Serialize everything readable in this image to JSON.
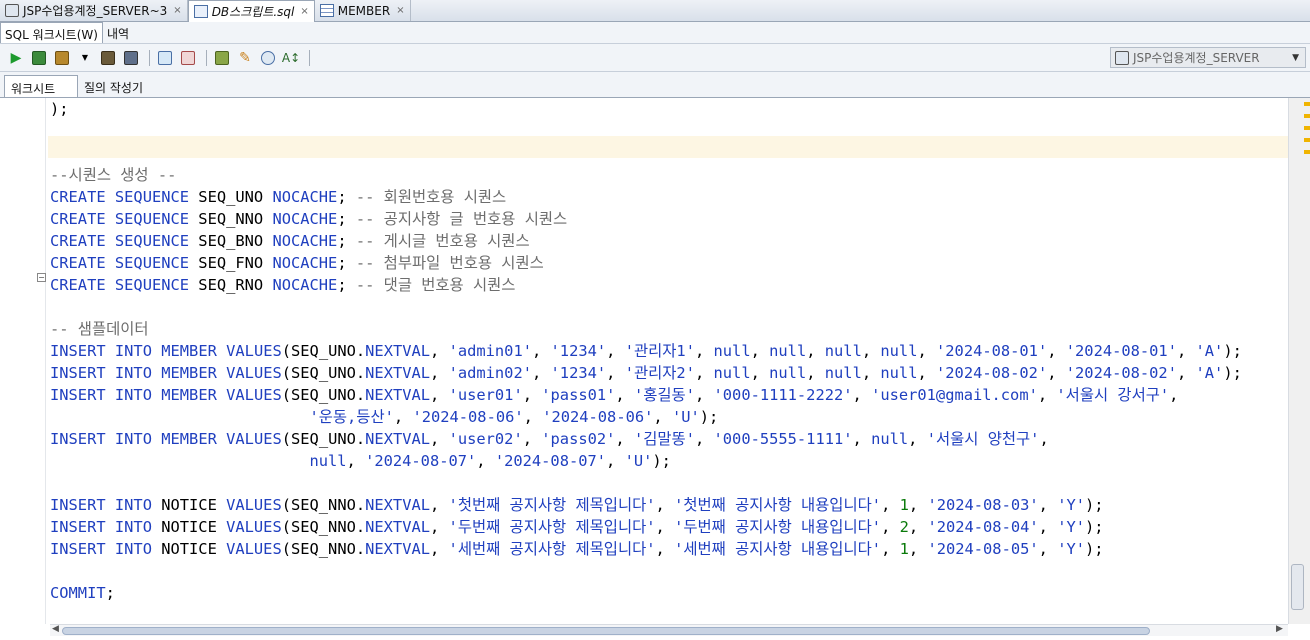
{
  "tabs": [
    {
      "label": "JSP수업용계정_SERVER~3",
      "icon": "database-icon",
      "close": "×"
    },
    {
      "label": "DB스크립트.sql",
      "icon": "sql-file-icon",
      "close": "×"
    },
    {
      "label": "MEMBER",
      "icon": "table-icon",
      "close": "×"
    }
  ],
  "subtabs": [
    "SQL 워크시트(W)",
    "내역"
  ],
  "connection": {
    "label": "JSP수업용계정_SERVER"
  },
  "worksheet_tabs": [
    "워크시트",
    "질의 작성기"
  ],
  "code_lines": [
    ");",
    "",
    "",
    "--시퀀스 생성 --",
    "CREATE SEQUENCE SEQ_UNO NOCACHE; -- 회원번호용 시퀀스",
    "CREATE SEQUENCE SEQ_NNO NOCACHE; -- 공지사항 글 번호용 시퀀스",
    "CREATE SEQUENCE SEQ_BNO NOCACHE; -- 게시글 번호용 시퀀스",
    "CREATE SEQUENCE SEQ_FNO NOCACHE; -- 첨부파일 번호용 시퀀스",
    "CREATE SEQUENCE SEQ_RNO NOCACHE; -- 댓글 번호용 시퀀스",
    "",
    "-- 샘플데이터",
    "INSERT INTO MEMBER VALUES(SEQ_UNO.NEXTVAL, 'admin01', '1234', '관리자1', null, null, null, null, '2024-08-01', '2024-08-01', 'A');",
    "INSERT INTO MEMBER VALUES(SEQ_UNO.NEXTVAL, 'admin02', '1234', '관리자2', null, null, null, null, '2024-08-02', '2024-08-02', 'A');",
    "INSERT INTO MEMBER VALUES(SEQ_UNO.NEXTVAL, 'user01', 'pass01', '홍길동', '000-1111-2222', 'user01@gmail.com', '서울시 강서구',",
    "                            '운동,등산', '2024-08-06', '2024-08-06', 'U');",
    "INSERT INTO MEMBER VALUES(SEQ_UNO.NEXTVAL, 'user02', 'pass02', '김말똥', '000-5555-1111', null, '서울시 양천구',",
    "                            null, '2024-08-07', '2024-08-07', 'U');",
    "",
    "INSERT INTO NOTICE VALUES(SEQ_NNO.NEXTVAL, '첫번째 공지사항 제목입니다', '첫번째 공지사항 내용입니다', 1, '2024-08-03', 'Y');",
    "INSERT INTO NOTICE VALUES(SEQ_NNO.NEXTVAL, '두번째 공지사항 제목입니다', '두번째 공지사항 내용입니다', 2, '2024-08-04', 'Y');",
    "INSERT INTO NOTICE VALUES(SEQ_NNO.NEXTVAL, '세번째 공지사항 제목입니다', '세번째 공지사항 내용입니다', 1, '2024-08-05', 'Y');",
    "",
    "COMMIT;"
  ],
  "colors": {
    "keyword": "#1f3fbf",
    "comment": "#6d6d6d",
    "number": "#0a7a0a",
    "current_line": "#fdf6e3"
  }
}
